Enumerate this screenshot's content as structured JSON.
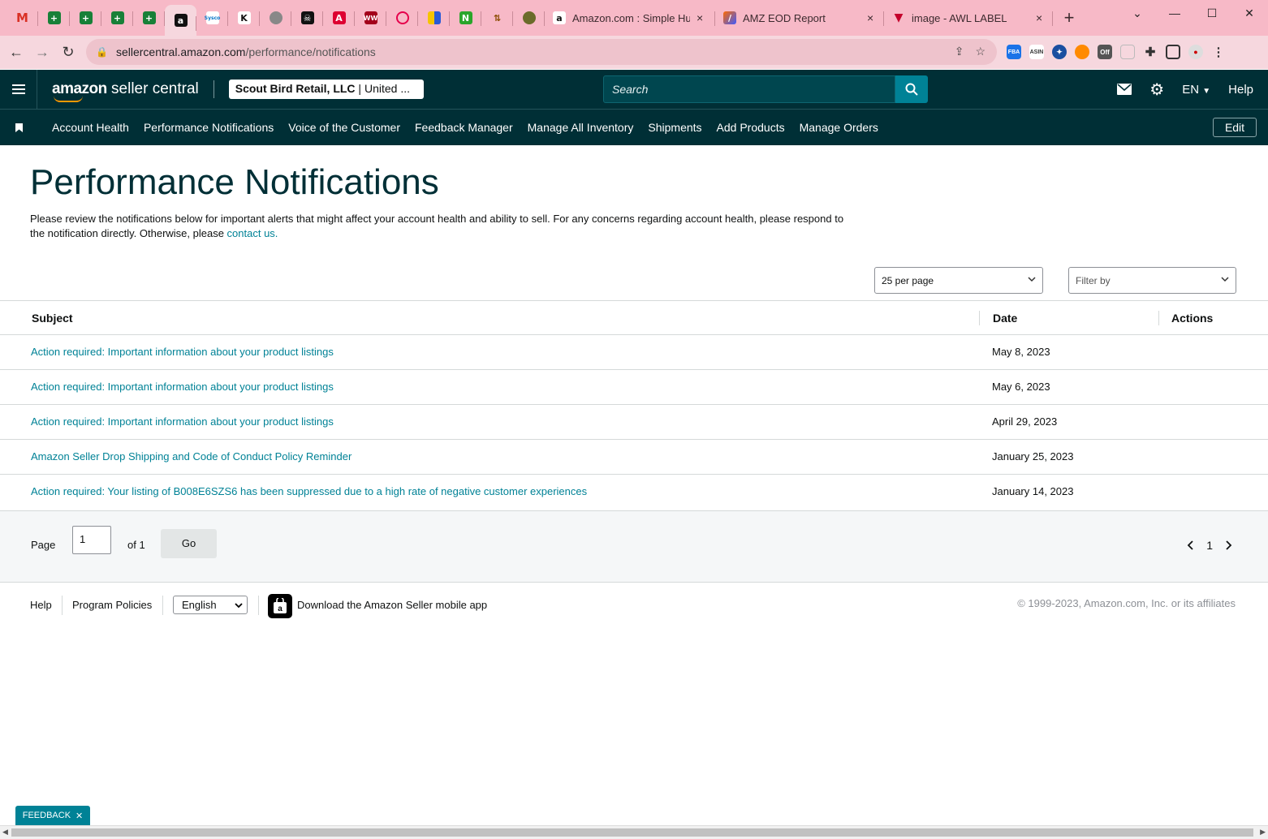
{
  "browser": {
    "tabs": [
      {
        "title": "Amazon.com : Simple Hum",
        "close": "×"
      },
      {
        "title": "AMZ EOD Report",
        "close": "×"
      },
      {
        "title": "image - AWL LABEL",
        "close": "×"
      }
    ],
    "new_tab": "+",
    "url_host": "sellercentral.amazon.com",
    "url_path": "/performance/notifications"
  },
  "header": {
    "logo_brand": "amazon",
    "logo_product": " seller central",
    "account_name": "Scout Bird Retail, LLC",
    "account_region": " | United ...",
    "search_placeholder": "Search",
    "language": "EN",
    "help": "Help"
  },
  "nav": {
    "links": [
      "Account Health",
      "Performance Notifications",
      "Voice of the Customer",
      "Feedback Manager",
      "Manage All Inventory",
      "Shipments",
      "Add Products",
      "Manage Orders"
    ],
    "edit": "Edit"
  },
  "main": {
    "title": "Performance Notifications",
    "intro": "Please review the notifications below for important alerts that might affect your account health and ability to sell. For any concerns regarding account health, please respond to the notification directly. Otherwise, please ",
    "intro_link": "contact us.",
    "per_page": "25 per page",
    "filter_placeholder": "Filter by"
  },
  "table": {
    "columns": [
      "Subject",
      "Date",
      "Actions"
    ],
    "rows": [
      {
        "subject": "Action required: Important information about your product listings",
        "date": "May 8, 2023"
      },
      {
        "subject": "Action required: Important information about your product listings",
        "date": "May 6, 2023"
      },
      {
        "subject": "Action required: Important information about your product listings",
        "date": "April 29, 2023"
      },
      {
        "subject": "Amazon Seller Drop Shipping and Code of Conduct Policy Reminder",
        "date": "January 25, 2023"
      },
      {
        "subject": "Action required: Your listing of B008E6SZS6 has been suppressed due to a high rate of negative customer experiences",
        "date": "January 14, 2023"
      }
    ]
  },
  "pager": {
    "page_label": "Page",
    "page_value": "1",
    "of_label": "of 1",
    "go": "Go",
    "current": "1"
  },
  "footer": {
    "help": "Help",
    "policies": "Program Policies",
    "language": "English",
    "app": "Download the Amazon Seller mobile app",
    "copyright": "© 1999-2023, Amazon.com, Inc. or its affiliates"
  },
  "feedback": "FEEDBACK",
  "colors": {
    "header_bg": "#002f36",
    "link": "#008296",
    "accent": "#ff9900",
    "browser_frame": "#f7b9c7"
  }
}
